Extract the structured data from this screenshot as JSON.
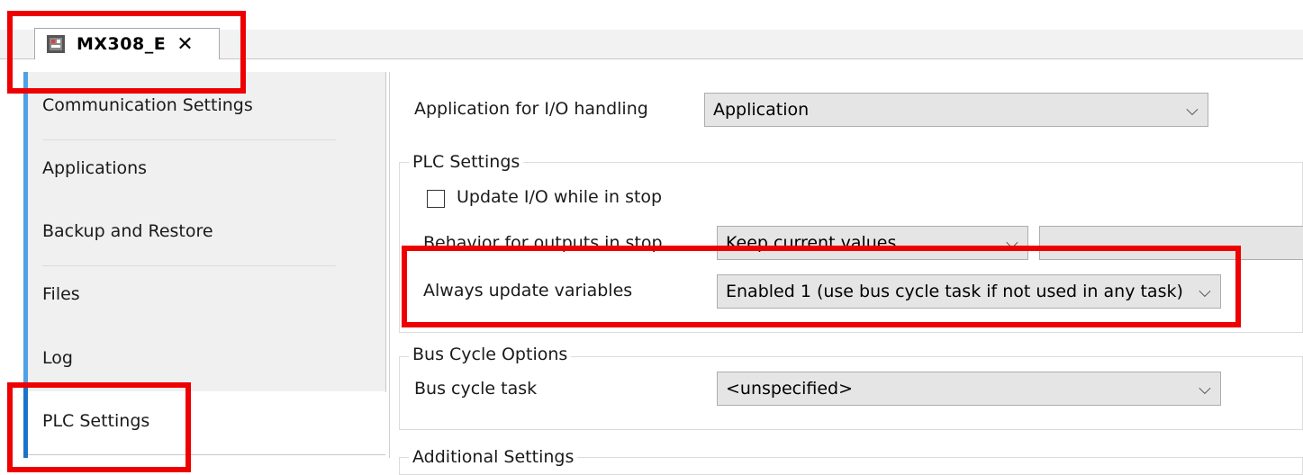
{
  "tab": {
    "title": "MX308_E",
    "close_glyph": "✕",
    "icon": "device-icon"
  },
  "nav": {
    "items": [
      {
        "label": "Communication Settings"
      },
      {
        "label": "Applications"
      },
      {
        "label": "Backup and Restore"
      },
      {
        "label": "Files"
      },
      {
        "label": "Log"
      },
      {
        "label": "PLC Settings"
      }
    ],
    "active": "PLC Settings"
  },
  "settings": {
    "app_io_label": "Application for I/O handling",
    "app_io_value": "Application",
    "plc_group_title": "PLC Settings",
    "update_io_label": "Update I/O while in stop",
    "update_io_checked": false,
    "behavior_label": "Behavior for outputs in stop",
    "behavior_value": "Keep current values",
    "always_update_label": "Always update variables",
    "always_update_value": "Enabled 1 (use bus cycle task if not used in any task)",
    "bus_group_title": "Bus Cycle Options",
    "bus_task_label": "Bus cycle task",
    "bus_task_value": "<unspecified>",
    "additional_group_title": "Additional Settings"
  },
  "chevron_glyph": "⌵",
  "colors": {
    "highlight": "#ee0000",
    "accent": "#1a73c9"
  }
}
